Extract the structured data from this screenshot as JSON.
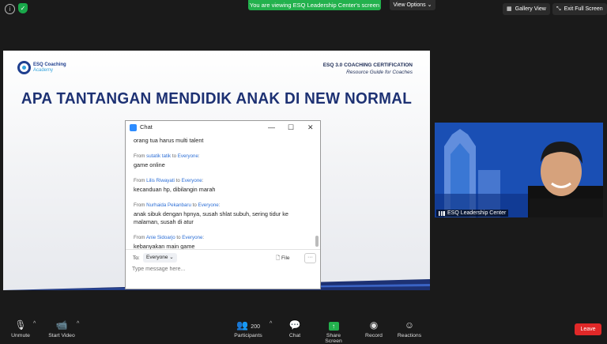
{
  "top": {
    "sharing_banner": "You are viewing ESQ Leadership Center's screen",
    "view_options": "View Options",
    "gallery_view": "Gallery View",
    "exit_full_screen": "Exit Full Screen"
  },
  "slide": {
    "logo_line1": "ESQ Coaching",
    "logo_line2": "Academy",
    "cert_title": "ESQ 3.0 COACHING CERTIFICATION",
    "cert_subtitle": "Resource Guide for Coaches",
    "heading": "APA TANTANGAN MENDIDIK ANAK DI NEW NORMAL"
  },
  "chat": {
    "title": "Chat",
    "first_line": "orang tua harus multi talent",
    "messages": [
      {
        "from": "sutatik tatik",
        "to": "Everyone",
        "text": "game online"
      },
      {
        "from": "Lilis Riwayati",
        "to": "Everyone",
        "text": "kecanduan hp, dibilangin marah"
      },
      {
        "from": "Nurhaida Pekanbaru",
        "to": "Everyone",
        "text": "anak sibuk dengan hpnya, susah shlat subuh, sering tidur ke malaman, susah di atur"
      },
      {
        "from": "Anie Sidoarjo",
        "to": "Everyone",
        "text": "kebanyakan main game"
      }
    ],
    "from_word": "From",
    "to_word": "to",
    "to_label": "To:",
    "recipient": "Everyone",
    "file_label": "File",
    "input_placeholder": "Type message here..."
  },
  "video": {
    "speaker_name": "ESQ Leadership Center"
  },
  "toolbar": {
    "unmute": "Unmute",
    "start_video": "Start Video",
    "participants_count": "200",
    "participants": "Participants",
    "chat": "Chat",
    "share_screen": "Share Screen",
    "record": "Record",
    "reactions": "Reactions",
    "leave": "Leave"
  },
  "colors": {
    "share_green": "#23b14d",
    "leave_red": "#e02828",
    "slide_navy": "#1d3173",
    "link_blue": "#2d6fd6"
  }
}
